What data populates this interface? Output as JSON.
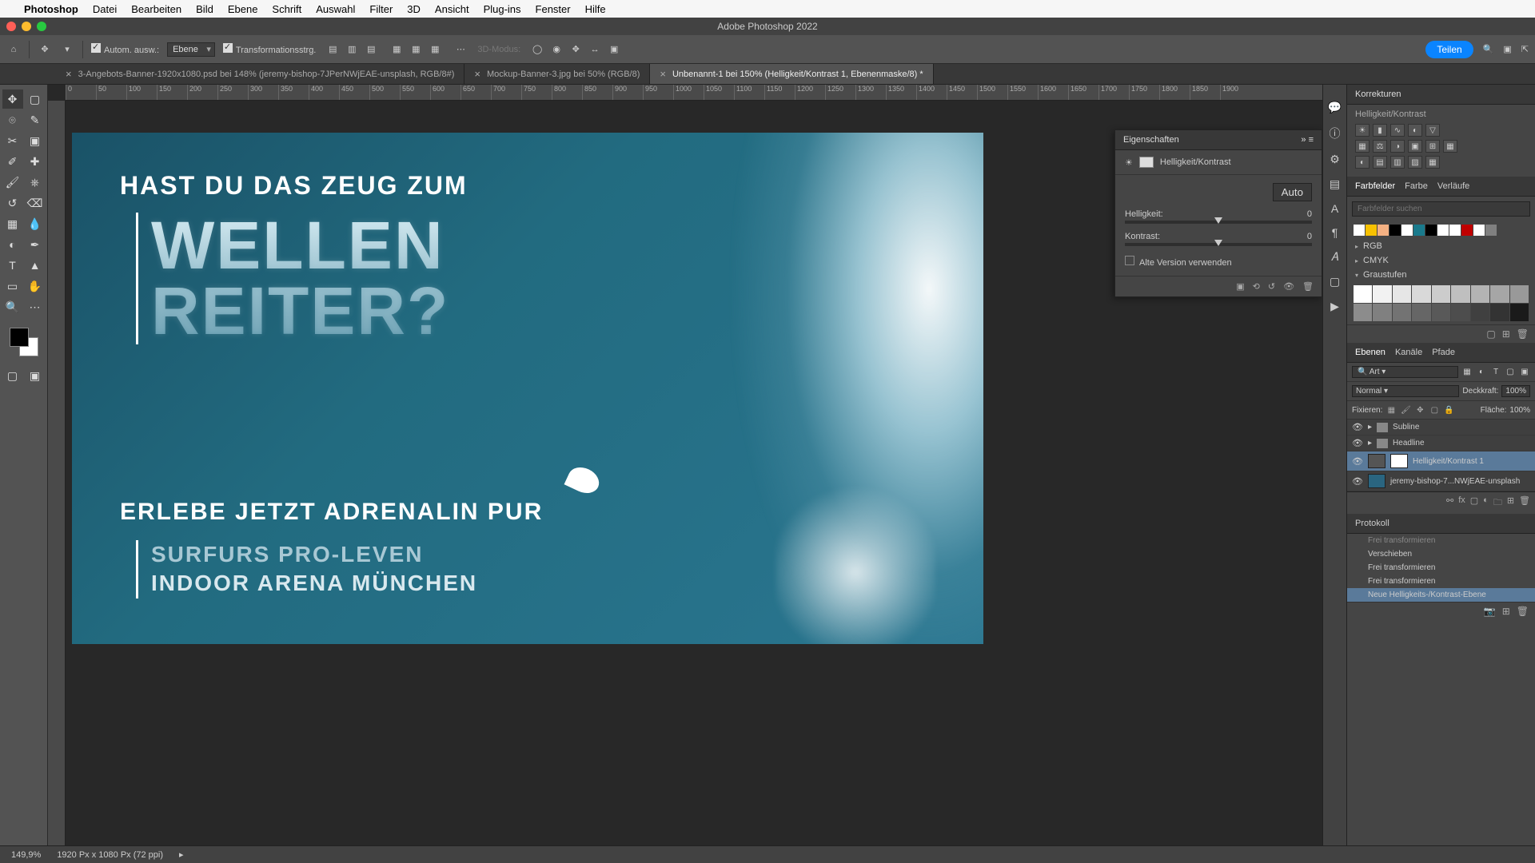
{
  "menubar": [
    "Photoshop",
    "Datei",
    "Bearbeiten",
    "Bild",
    "Ebene",
    "Schrift",
    "Auswahl",
    "Filter",
    "3D",
    "Ansicht",
    "Plug-ins",
    "Fenster",
    "Hilfe"
  ],
  "app_title": "Adobe Photoshop 2022",
  "optionbar": {
    "auto_select": "Autom. ausw.:",
    "layer_mode": "Ebene",
    "transform_controls": "Transformationsstrg.",
    "mode3d": "3D-Modus:",
    "share": "Teilen"
  },
  "tabs": [
    {
      "label": "3-Angebots-Banner-1920x1080.psd bei 148% (jeremy-bishop-7JPerNWjEAE-unsplash, RGB/8#)",
      "active": false
    },
    {
      "label": "Mockup-Banner-3.jpg bei 50% (RGB/8)",
      "active": false
    },
    {
      "label": "Unbenannt-1 bei 150% (Helligkeit/Kontrast 1, Ebenenmaske/8) *",
      "active": true
    }
  ],
  "ruler_ticks": [
    "0",
    "50",
    "100",
    "150",
    "200",
    "250",
    "300",
    "350",
    "400",
    "450",
    "500",
    "550",
    "600",
    "650",
    "700",
    "750",
    "800",
    "850",
    "900",
    "950",
    "1000",
    "1050",
    "1100",
    "1150",
    "1200",
    "1250",
    "1300",
    "1350",
    "1400",
    "1450",
    "1500",
    "1550",
    "1600",
    "1650",
    "1700",
    "1750",
    "1800",
    "1850",
    "1900"
  ],
  "canvas_text": {
    "pre": "HAST DU DAS ZEUG ZUM",
    "main1": "WELLEN",
    "main2": "REITER?",
    "sub": "ERLEBE JETZT ADRENALIN PUR",
    "sub2a": "SURFURS PRO-LEVEN",
    "sub2b": "INDOOR ARENA MÜNCHEN"
  },
  "properties": {
    "title": "Eigenschaften",
    "type": "Helligkeit/Kontrast",
    "auto": "Auto",
    "brightness_label": "Helligkeit:",
    "brightness_value": "0",
    "contrast_label": "Kontrast:",
    "contrast_value": "0",
    "legacy": "Alte Version verwenden"
  },
  "adjustments": {
    "title": "Korrekturen",
    "subtitle": "Helligkeit/Kontrast"
  },
  "swatches": {
    "tabs": [
      "Farbfelder",
      "Farbe",
      "Verläufe"
    ],
    "search_placeholder": "Farbfelder suchen",
    "top_colors": [
      "#ffffff",
      "#f8c100",
      "#f4b183",
      "#000000",
      "#ffffff",
      "#1a7a8c",
      "#000000",
      "#ffffff",
      "#ffffff",
      "#c00000",
      "#ffffff",
      "#808080"
    ],
    "folders": [
      "RGB",
      "CMYK",
      "Graustufen"
    ],
    "grays": [
      "#ffffff",
      "#f2f2f2",
      "#e6e6e6",
      "#d9d9d9",
      "#cccccc",
      "#bfbfbf",
      "#b3b3b3",
      "#a6a6a6",
      "#999999",
      "#8c8c8c",
      "#808080",
      "#737373",
      "#666666",
      "#595959",
      "#4d4d4d",
      "#404040",
      "#333333",
      "#1a1a1a"
    ]
  },
  "layers": {
    "tabs": [
      "Ebenen",
      "Kanäle",
      "Pfade"
    ],
    "kind": "Art",
    "blend": "Normal",
    "opacity_label": "Deckkraft:",
    "opacity": "100%",
    "lock_label": "Fixieren:",
    "fill_label": "Fläche:",
    "fill": "100%",
    "items": [
      {
        "name": "Subline",
        "type": "group"
      },
      {
        "name": "Headline",
        "type": "group"
      },
      {
        "name": "Helligkeit/Kontrast 1",
        "type": "adj",
        "selected": true
      },
      {
        "name": "jeremy-bishop-7...NWjEAE-unsplash",
        "type": "smart"
      }
    ]
  },
  "history": {
    "title": "Protokoll",
    "items": [
      "Frei transformieren",
      "Verschieben",
      "Frei transformieren",
      "Frei transformieren",
      "Neue Helligkeits-/Kontrast-Ebene"
    ]
  },
  "statusbar": {
    "zoom": "149,9%",
    "docinfo": "1920 Px x 1080 Px (72 ppi)"
  }
}
